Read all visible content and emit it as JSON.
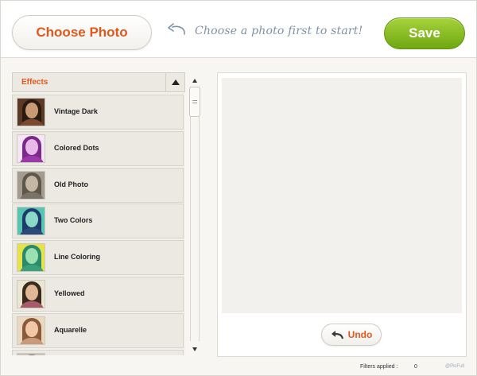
{
  "header": {
    "choose_label": "Choose Photo",
    "hint": "Choose a photo first to start!",
    "save_label": "Save"
  },
  "effects": {
    "title": "Effects",
    "items": [
      {
        "label": "Vintage Dark",
        "style": "vintage"
      },
      {
        "label": "Colored Dots",
        "style": "dots"
      },
      {
        "label": "Old Photo",
        "style": "old"
      },
      {
        "label": "Two Colors",
        "style": "two"
      },
      {
        "label": "Line Coloring",
        "style": "line"
      },
      {
        "label": "Yellowed",
        "style": "yellow"
      },
      {
        "label": "Aquarelle",
        "style": "aqua"
      },
      {
        "label": "",
        "style": "partial"
      }
    ]
  },
  "preview": {
    "undo_label": "Undo"
  },
  "status": {
    "filters_label": "Filters applied :",
    "filters_count": "0",
    "brand": "@PicFull"
  },
  "colors": {
    "accent": "#e2581b",
    "save_green": "#7cb518",
    "hint_blue": "#7f91a4"
  }
}
